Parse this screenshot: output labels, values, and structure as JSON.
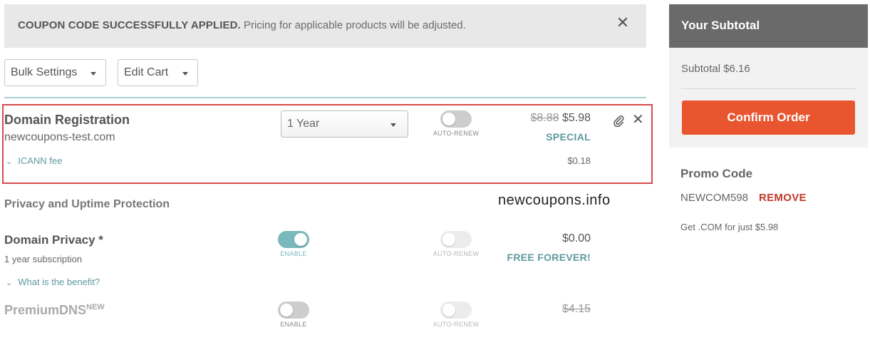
{
  "alert": {
    "bold": "COUPON CODE SUCCESSFULLY APPLIED.",
    "text": "Pricing for applicable products will be adjusted.",
    "close_glyph": "✕"
  },
  "toolbar": {
    "bulk_settings": "Bulk Settings",
    "edit_cart": "Edit Cart"
  },
  "domain_reg": {
    "title": "Domain Registration",
    "domain": "newcoupons-test.com",
    "period": "1 Year",
    "autorenew_label": "AUTO-RENEW",
    "old_price": "$8.88",
    "price": "$5.98",
    "badge": "SPECIAL",
    "fee_label": "ICANN fee",
    "fee_price": "$0.18"
  },
  "section_header": "Privacy and Uptime Protection",
  "watermark": "newcoupons.info",
  "privacy": {
    "title": "Domain Privacy *",
    "subtitle": "1 year subscription",
    "enable_label": "ENABLE",
    "autorenew_label": "AUTO-RENEW",
    "price": "$0.00",
    "badge": "FREE FOREVER!",
    "benefit_link": "What is the benefit?"
  },
  "premium_dns": {
    "title": "PremiumDNS",
    "badge": "NEW",
    "enable_label": "ENABLE",
    "autorenew_label": "AUTO-RENEW",
    "price": "$4.15"
  },
  "sidebar": {
    "heading": "Your Subtotal",
    "subtotal": "Subtotal $6.16",
    "confirm": "Confirm Order"
  },
  "promo": {
    "heading": "Promo Code",
    "code": "NEWCOM598",
    "remove": "REMOVE",
    "description": "Get .COM for just $5.98"
  },
  "colors": {
    "accent_teal": "#7ab8bd",
    "confirm_orange": "#e9552e",
    "remove_red": "#c0392b",
    "highlight_red": "#d84a4a"
  }
}
